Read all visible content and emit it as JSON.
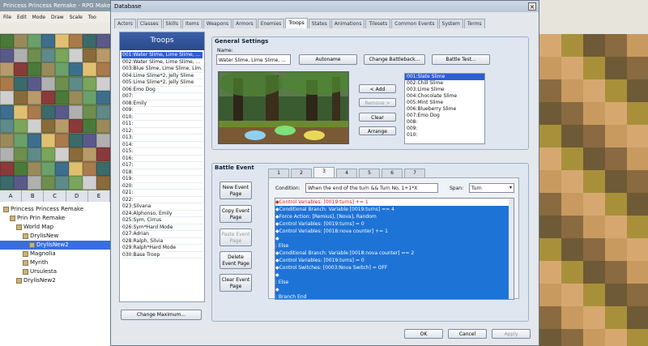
{
  "editor": {
    "title": "Princess Princess Remake - RPG Maker",
    "menu": [
      "File",
      "Edit",
      "Mode",
      "Draw",
      "Scale",
      "Too"
    ],
    "tile_tabs": [
      "A",
      "B",
      "C",
      "D",
      "E"
    ],
    "map_tree": [
      {
        "label": "Princess Princess Remake",
        "indent": 0
      },
      {
        "label": "Prin Prin Remake",
        "indent": 1
      },
      {
        "label": "World Map",
        "indent": 2
      },
      {
        "label": "DrylisNew",
        "indent": 3
      },
      {
        "label": "DrylisNew2",
        "indent": 4,
        "selected": true
      },
      {
        "label": "Magnolia",
        "indent": 3
      },
      {
        "label": "Myrith",
        "indent": 3
      },
      {
        "label": "Ursulesta",
        "indent": 3
      },
      {
        "label": "DrylisNew2",
        "indent": 2
      }
    ]
  },
  "dialog": {
    "title": "Database",
    "tabs": [
      "Actors",
      "Classes",
      "Skills",
      "Items",
      "Weapons",
      "Armors",
      "Enemies",
      "Troops",
      "States",
      "Animations",
      "Tilesets",
      "Common Events",
      "System",
      "Terms"
    ],
    "active_tab": "Troops",
    "troops_header": "Troops",
    "troops": [
      "001:Water Slime, Lime Slime, ...",
      "002:Water Slime, Lime Slime, ...",
      "003:Blue Slime, Lime Slime, Lim...",
      "004:Lime Slime*2, Jelly Slime",
      "005:Lime Slime*2, Jelly Slime",
      "006:Emo Dog",
      "007:",
      "008:Emily",
      "009:",
      "010:",
      "011:",
      "012:",
      "013:",
      "014:",
      "015:",
      "016:",
      "017:",
      "018:",
      "019:",
      "020:",
      "021:",
      "022:",
      "023:Silvana",
      "024:Alphonso, Emily",
      "025:Sym, Cirrus",
      "026:Sym*Hard Mode",
      "027:Adrian",
      "028:Ralph, Silvia",
      "029:Ralph*Hard Mode",
      "030:Base Troop"
    ],
    "change_maximum": "Change Maximum...",
    "general_settings": {
      "title": "General Settings",
      "name_label": "Name:",
      "name_value": "Water Slime, Lime Slime, ...",
      "autoname": "Autoname",
      "change_battleback": "Change Battleback...",
      "battle_test": "Battle Test...",
      "add": "< Add",
      "remove": "Remove >",
      "clear": "Clear",
      "arrange": "Arrange",
      "enemies": [
        "001:Slate Slime",
        "002:Chill Slime",
        "003:Lime Slime",
        "004:Chocolate Slime",
        "005:Mint Slime",
        "006:Blueberry Slime",
        "007:Emo Dog",
        "008:",
        "009:",
        "010:"
      ]
    },
    "battle_event": {
      "title": "Battle Event",
      "pages": [
        "1",
        "2",
        "3",
        "4",
        "5",
        "6",
        "7"
      ],
      "active_page": "3",
      "new_page": "New Event Page",
      "copy_page": "Copy Event Page",
      "paste_page": "Paste Event Page",
      "delete_page": "Delete Event Page",
      "clear_page": "Clear Event Page",
      "condition_label": "Condition:",
      "condition_value": "When the end of the turn && Turn No. 1+1*X",
      "span_label": "Span:",
      "span_value": "Turn",
      "commands": [
        "◆Control Variables: [0019:turns] += 1",
        "◆Conditional Branch: Variable [0019:turns] == 4",
        "  ◆Force Action: [Remius], [Nova], Random",
        "  ◆Control Variables: [0019:turns] = 0",
        "  ◆Control Variables: [0018:nova counter] += 1",
        "  ◆",
        ": Else",
        "  ◆Conditional Branch: Variable [0018:nova counter] == 2",
        "    ◆Control Variables: [0019:turns] = 0",
        "    ◆Control Switches: [0003:Nova Switch] = OFF",
        "    ◆",
        "  : Else",
        "    ◆",
        "  : Branch End"
      ]
    },
    "ok": "OK",
    "cancel": "Cancel",
    "apply": "Apply"
  }
}
